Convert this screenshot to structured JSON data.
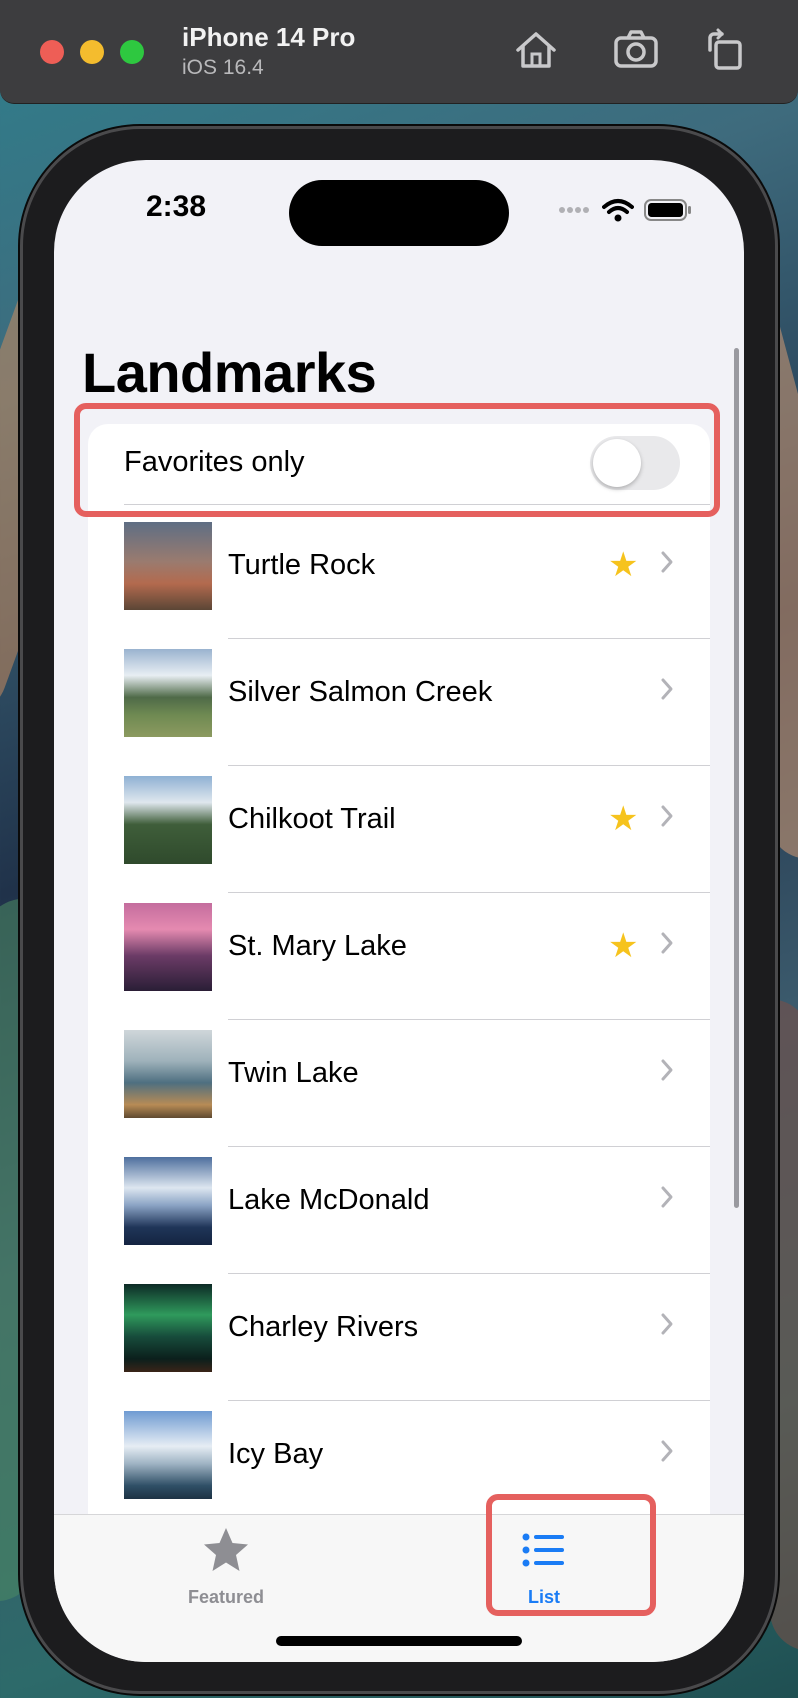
{
  "simulator": {
    "device_name": "iPhone 14 Pro",
    "os_version": "iOS 16.4",
    "toolbar_icons": [
      "home-icon",
      "screenshot-icon",
      "rotate-icon"
    ]
  },
  "status_bar": {
    "time": "2:38"
  },
  "page": {
    "title": "Landmarks",
    "favorites_toggle": {
      "label": "Favorites only",
      "on": false
    }
  },
  "landmarks": [
    {
      "name": "Turtle Rock",
      "favorite": true
    },
    {
      "name": "Silver Salmon Creek",
      "favorite": false
    },
    {
      "name": "Chilkoot Trail",
      "favorite": true
    },
    {
      "name": "St. Mary Lake",
      "favorite": true
    },
    {
      "name": "Twin Lake",
      "favorite": false
    },
    {
      "name": "Lake McDonald",
      "favorite": false
    },
    {
      "name": "Charley Rivers",
      "favorite": false
    },
    {
      "name": "Icy Bay",
      "favorite": false
    }
  ],
  "tab_bar": {
    "tabs": [
      {
        "label": "Featured",
        "icon": "star-icon",
        "selected": false
      },
      {
        "label": "List",
        "icon": "list-icon",
        "selected": true
      }
    ]
  },
  "colors": {
    "accent": "#1a7cf5",
    "favorite_star": "#f6c31d",
    "highlight_border": "#e5605e",
    "tab_inactive": "#8e8e93"
  }
}
